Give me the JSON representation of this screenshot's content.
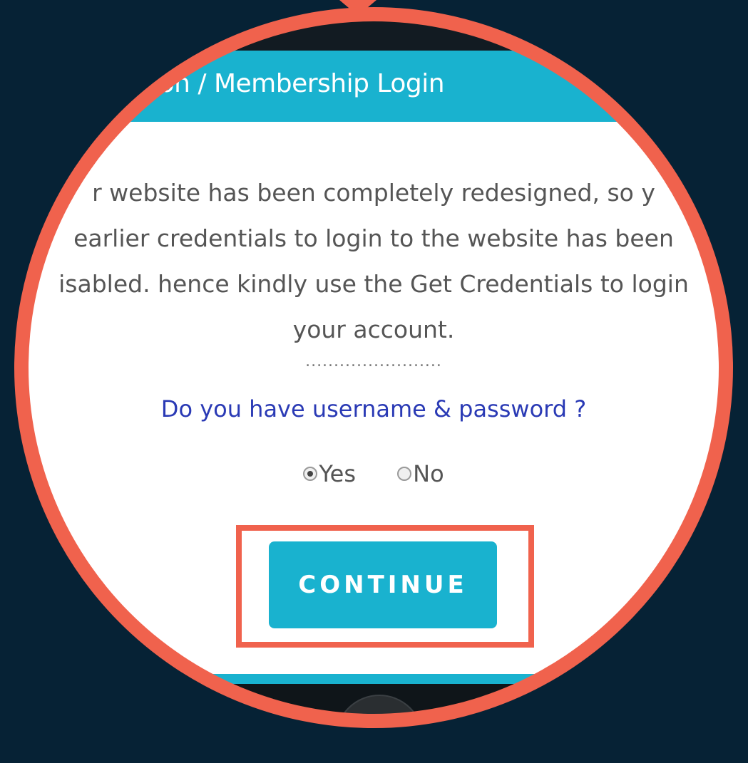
{
  "header": {
    "title": "tration / Membership Login"
  },
  "message": {
    "lines": [
      "r website has been completely redesigned, so y",
      "earlier credentials to login to the website has been",
      "isabled. hence kindly use the Get Credentials to login",
      "your account."
    ]
  },
  "separator": "........................",
  "question": "Do you have username & password ?",
  "radio": {
    "options": [
      {
        "label": "Yes",
        "checked": true
      },
      {
        "label": "No",
        "checked": false
      }
    ]
  },
  "continue_button": {
    "label": "CONTINUE"
  },
  "colors": {
    "background": "#062235",
    "accent": "#19b2cf",
    "highlight": "#f0624d",
    "question_text": "#2a3ab5",
    "body_text": "#555555"
  }
}
